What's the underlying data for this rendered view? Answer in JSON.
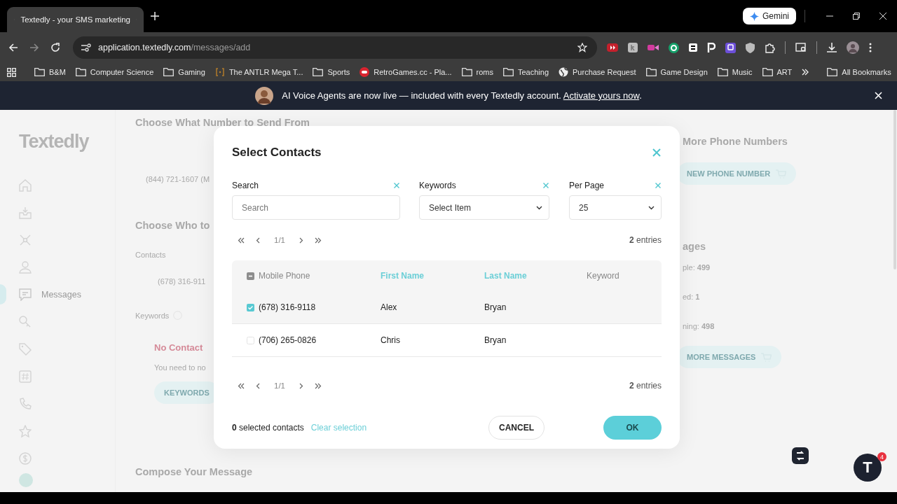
{
  "browser": {
    "tabs": [
      {
        "title": "Textedly - your SMS marketing",
        "selected": true
      }
    ],
    "url": {
      "host": "application.textedly.com",
      "path": "/messages/add"
    },
    "gemini": "Gemini",
    "bookmarks": [
      {
        "label": "B&M",
        "kind": "folder"
      },
      {
        "label": "Computer Science",
        "kind": "folder"
      },
      {
        "label": "Gaming",
        "kind": "folder"
      },
      {
        "label": "The ANTLR Mega T...",
        "kind": "bracket"
      },
      {
        "label": "Sports",
        "kind": "folder"
      },
      {
        "label": "RetroGames.cc - Pla...",
        "kind": "gamepad"
      },
      {
        "label": "roms",
        "kind": "folder"
      },
      {
        "label": "Teaching",
        "kind": "folder"
      },
      {
        "label": "Purchase Request",
        "kind": "globe"
      },
      {
        "label": "Game Design",
        "kind": "folder"
      },
      {
        "label": "Music",
        "kind": "folder"
      },
      {
        "label": "ART",
        "kind": "folder"
      }
    ],
    "all_bookmarks": "All Bookmarks"
  },
  "banner": {
    "text": "AI Voice Agents are now live — included with every Textedly account.",
    "link": "Activate yours now",
    "end": "."
  },
  "sidebar": {
    "logo": "Textedly",
    "items": [
      {
        "kind": "home",
        "selected": false
      },
      {
        "kind": "inbox",
        "selected": false
      },
      {
        "kind": "network",
        "selected": false
      },
      {
        "kind": "person",
        "selected": false
      },
      {
        "kind": "chat",
        "label": "Messages",
        "selected": true
      },
      {
        "kind": "key",
        "selected": false
      },
      {
        "kind": "tag",
        "selected": false
      },
      {
        "kind": "hash",
        "selected": false
      },
      {
        "kind": "phone",
        "selected": false
      },
      {
        "kind": "star",
        "selected": false
      },
      {
        "kind": "dollar",
        "selected": false
      },
      {
        "kind": "avatar",
        "selected": false
      }
    ]
  },
  "background_left": [
    {
      "kind": "heading",
      "text": "Choose What Number to Send From"
    },
    {
      "kind": "value",
      "text": "(844) 721-1607 (M"
    },
    {
      "kind": "heading",
      "text": "Choose Who to"
    },
    {
      "kind": "label",
      "text": "Contacts"
    },
    {
      "kind": "value2",
      "text": "(678) 316-911"
    },
    {
      "kind": "help",
      "text": "Keywords"
    },
    {
      "kind": "alert",
      "text": "No Contact"
    },
    {
      "kind": "note",
      "text": "You need to no"
    },
    {
      "kind": "button",
      "text": "KEYWORDS"
    },
    {
      "kind": "heading2",
      "text": "Compose Your Message"
    }
  ],
  "background_right": [
    {
      "kind": "heading",
      "text": "More Phone Numbers"
    },
    {
      "kind": "button",
      "text": "NEW PHONE NUMBER"
    },
    {
      "kind": "heading",
      "text": "ages"
    },
    {
      "kind": "stat",
      "text": "ple: **499**"
    },
    {
      "kind": "stat",
      "text": "ed: **1**"
    },
    {
      "kind": "stat",
      "text": "ning: **498**"
    },
    {
      "kind": "button",
      "text": "MORE MESSAGES"
    }
  ],
  "modal": {
    "title": "Select Contacts",
    "filters": [
      {
        "label": "Search",
        "kind": "text",
        "placeholder": "Search"
      },
      {
        "label": "Keywords",
        "kind": "select",
        "value": "Select Item"
      },
      {
        "label": "Per Page",
        "kind": "select",
        "value": "25"
      }
    ],
    "pagination_top": {
      "page": "1/1",
      "entries": "**2** entries"
    },
    "header_checkbox": {
      "indeterminate": true
    },
    "columns": [
      {
        "label": "Mobile Phone",
        "sorted": false
      },
      {
        "label": "First Name",
        "sorted": true
      },
      {
        "label": "Last Name",
        "sorted": true
      },
      {
        "label": "Keyword",
        "sorted": false
      }
    ],
    "rows": [
      {
        "phone": "(678) 316-9118",
        "first": "Alex",
        "last": "Bryan",
        "checked": true,
        "highlighted": true
      },
      {
        "phone": "(706) 265-0826",
        "first": "Chris",
        "last": "Bryan",
        "checked": false,
        "highlighted": false
      }
    ],
    "pagination_bottom": {
      "page": "1/1",
      "entries": "**2** entries"
    },
    "selected_summary": "**0** selected contacts",
    "clear": "Clear selection",
    "cancel": "CANCEL",
    "ok": "OK"
  },
  "chat_widget": {
    "label": "T",
    "badge": "4"
  }
}
